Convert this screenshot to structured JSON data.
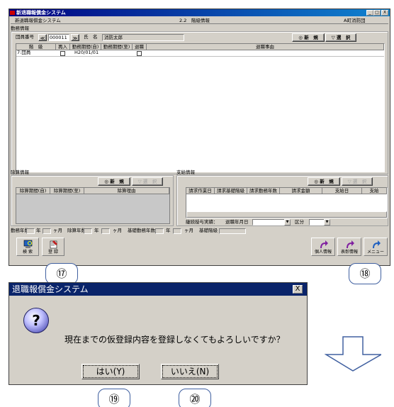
{
  "main": {
    "app_title": "新退職報償金システム",
    "subheader": {
      "left": "新退職報償金システム",
      "center": "2.2　階級情報",
      "right": "A町消防団"
    },
    "window_controls": [
      "_",
      "□",
      "X"
    ]
  },
  "kinmu": {
    "section_label": "勤務情報",
    "member_no_label": "団員番号",
    "member_no_value": "000011",
    "nav_prev": "≪",
    "nav_next": "≫",
    "name_label": "氏　名",
    "name_value": "消防太郎",
    "new_button": "◎ 新　規",
    "select_button": "▽ 選　択",
    "columns": [
      "階　級",
      "再入",
      "勤務期間(自)",
      "勤務期間(至)",
      "退職",
      "退職事由"
    ],
    "rows": [
      {
        "rank": "7:団員",
        "reentry": "",
        "from": "H20/01/01",
        "to": "",
        "retire": "",
        "reason": ""
      }
    ]
  },
  "sanjo": {
    "section_label": "除算情報",
    "new_button": "◎ 新　規",
    "select_button": "▽ 選　択",
    "columns": [
      "除算期間(自)",
      "除算期間(至)",
      "除算理由"
    ]
  },
  "shikyu": {
    "section_label": "支給情報",
    "new_button": "◎ 新　規",
    "select_button": "▽ 選　択",
    "columns": [
      "請求作業日",
      "請求基礎階級",
      "請求勤務年数",
      "請求金額",
      "支給日",
      "支給"
    ],
    "extra_label": "継続授与実績：",
    "retire_date_label": "退職年月日",
    "kubun_label": "区分"
  },
  "summary": {
    "kinmu_years_label": "勤務年数",
    "nen": "年",
    "kagetsu": "ヶ月",
    "jozan_years_label": "除算年数",
    "kiso_years_label": "基礎勤務年数",
    "kiso_rank_label": "基礎階級"
  },
  "toolbar": {
    "search_label": "検 索",
    "register_label": "登 録",
    "personal_label": "個人情報",
    "commend_label": "表彰情報",
    "menu_label": "メニュー"
  },
  "callouts": {
    "c17": "⑰",
    "c18": "⑱",
    "c19": "⑲",
    "c20": "⑳"
  },
  "dialog": {
    "title": "退職報償金システム",
    "close": "X",
    "icon_glyph": "?",
    "message": "現在までの仮登録内容を登録しなくてもよろしいですか？",
    "yes_button": "はい(Y)",
    "no_button": "いいえ(N)"
  },
  "colors": {
    "title_blue": "#0a246a",
    "face": "#d4d0c8",
    "arrow_blue": "#4060a0",
    "callout_border": "#4060a0"
  },
  "icons": {
    "search": "search-icon",
    "register": "register-icon",
    "personal": "arrow-icon",
    "down_arrow": "down-arrow-icon"
  }
}
